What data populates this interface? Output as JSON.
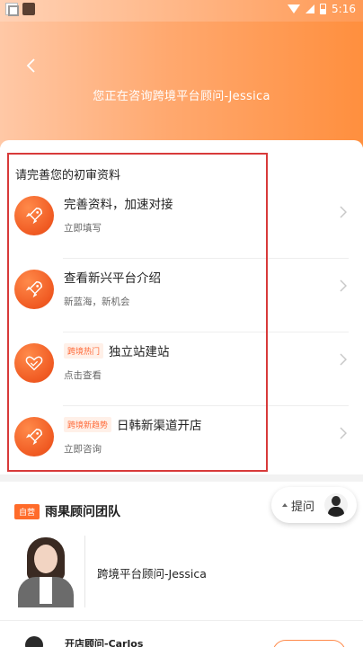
{
  "status_bar": {
    "time": "5:16"
  },
  "header": {
    "title": "您正在咨询跨境平台顾问-Jessica"
  },
  "profile_card": {
    "heading": "请完善您的初审资料",
    "items": [
      {
        "title": "完善资料，加速对接",
        "subtitle": "立即填写",
        "tag": "",
        "icon": "rocket-icon"
      },
      {
        "title": "查看新兴平台介绍",
        "subtitle": "新蓝海，新机会",
        "tag": "",
        "icon": "rocket-icon"
      },
      {
        "title": "独立站建站",
        "subtitle": "点击查看",
        "tag": "跨境热门",
        "icon": "heart-hands-icon"
      },
      {
        "title": "日韩新渠道开店",
        "subtitle": "立即咨询",
        "tag": "跨境新趋势",
        "icon": "rocket-icon"
      }
    ]
  },
  "team": {
    "badge": "自营",
    "title": "雨果顾问团队",
    "ask_button": "提问",
    "advisors": [
      {
        "name": "跨境平台顾问-Jessica"
      },
      {
        "name": "开店顾问-Carlos"
      }
    ]
  },
  "colors": {
    "accent": "#ff6b2a",
    "highlight_border": "#d83a3a"
  }
}
